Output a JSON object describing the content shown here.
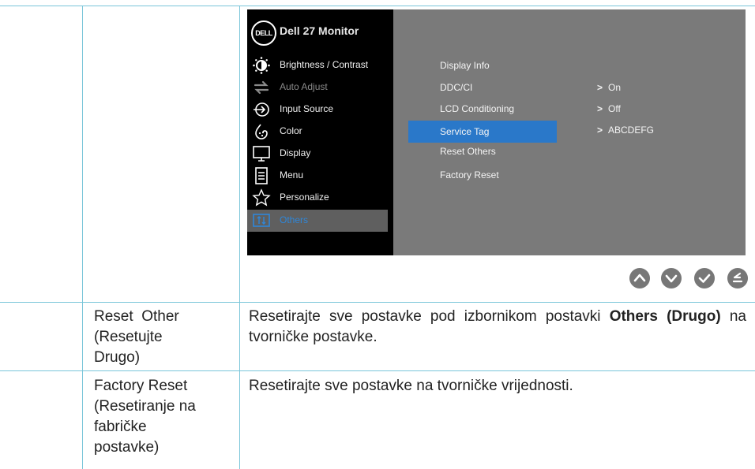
{
  "osd": {
    "logo_text": "DELL",
    "title": "Dell 27 Monitor",
    "menu": [
      {
        "label": "Brightness / Contrast",
        "icon": "brightness-icon"
      },
      {
        "label": "Auto Adjust",
        "icon": "auto-adjust-icon"
      },
      {
        "label": "Input Source",
        "icon": "input-source-icon"
      },
      {
        "label": "Color",
        "icon": "color-icon"
      },
      {
        "label": "Display",
        "icon": "display-icon"
      },
      {
        "label": "Menu",
        "icon": "menu-icon"
      },
      {
        "label": "Personalize",
        "icon": "star-icon"
      },
      {
        "label": "Others",
        "icon": "others-icon"
      }
    ],
    "submenu": [
      {
        "label": "Display Info"
      },
      {
        "label": "DDC/CI",
        "value": "On"
      },
      {
        "label": "LCD Conditioning",
        "value": "Off"
      },
      {
        "label": "Service Tag",
        "value": "ABCDEFG"
      },
      {
        "label": "Reset Others"
      },
      {
        "label": "Factory Reset"
      }
    ],
    "chevron": ">",
    "buttons": [
      "up-button-icon",
      "down-button-icon",
      "check-button-icon",
      "back-button-icon"
    ],
    "colors": {
      "panel_left": "#000000",
      "panel_right": "#7a7a7a",
      "selection": "#2a78c9",
      "accent_text": "#2f86d8"
    }
  },
  "rows": [
    {
      "name": "Reset Other (Resetujte Drugo)",
      "name_lines": [
        "Reset  Other",
        "(Resetujte",
        "Drugo)"
      ],
      "desc_pre": "Resetirajte sve postavke pod izbornikom postavki ",
      "desc_bold": "Others (Drugo)",
      "desc_post": " na tvorničke postavke."
    },
    {
      "name_lines": [
        "Factory Reset",
        "(Resetiranje na",
        "fabričke",
        "postavke)"
      ],
      "desc": "Resetirajte sve postavke na tvorničke vrijednosti."
    }
  ]
}
